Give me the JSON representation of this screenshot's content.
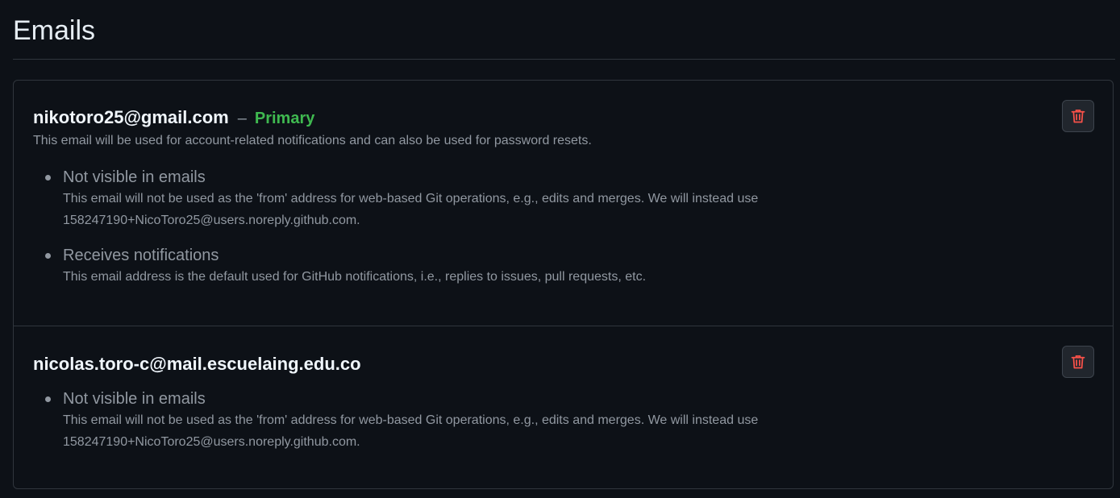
{
  "page": {
    "title": "Emails"
  },
  "colors": {
    "background": "#0d1117",
    "primary_label": "#3fb950",
    "delete_icon": "#f85149",
    "border": "#30363d",
    "muted_text": "#9198a1"
  },
  "emails": [
    {
      "address": "nikotoro25@gmail.com",
      "separator": "–",
      "badge": "Primary",
      "description": "This email will be used for account-related notifications and can also be used for password resets.",
      "delete_icon": "trash-icon",
      "properties": [
        {
          "title": "Not visible in emails",
          "description": "This email will not be used as the 'from' address for web-based Git operations, e.g., edits and merges. We will instead use 158247190+NicoToro25@users.noreply.github.com."
        },
        {
          "title": "Receives notifications",
          "description": "This email address is the default used for GitHub notifications, i.e., replies to issues, pull requests, etc."
        }
      ]
    },
    {
      "address": "nicolas.toro-c@mail.escuelaing.edu.co",
      "delete_icon": "trash-icon",
      "properties": [
        {
          "title": "Not visible in emails",
          "description": "This email will not be used as the 'from' address for web-based Git operations, e.g., edits and merges. We will instead use 158247190+NicoToro25@users.noreply.github.com."
        }
      ]
    }
  ]
}
